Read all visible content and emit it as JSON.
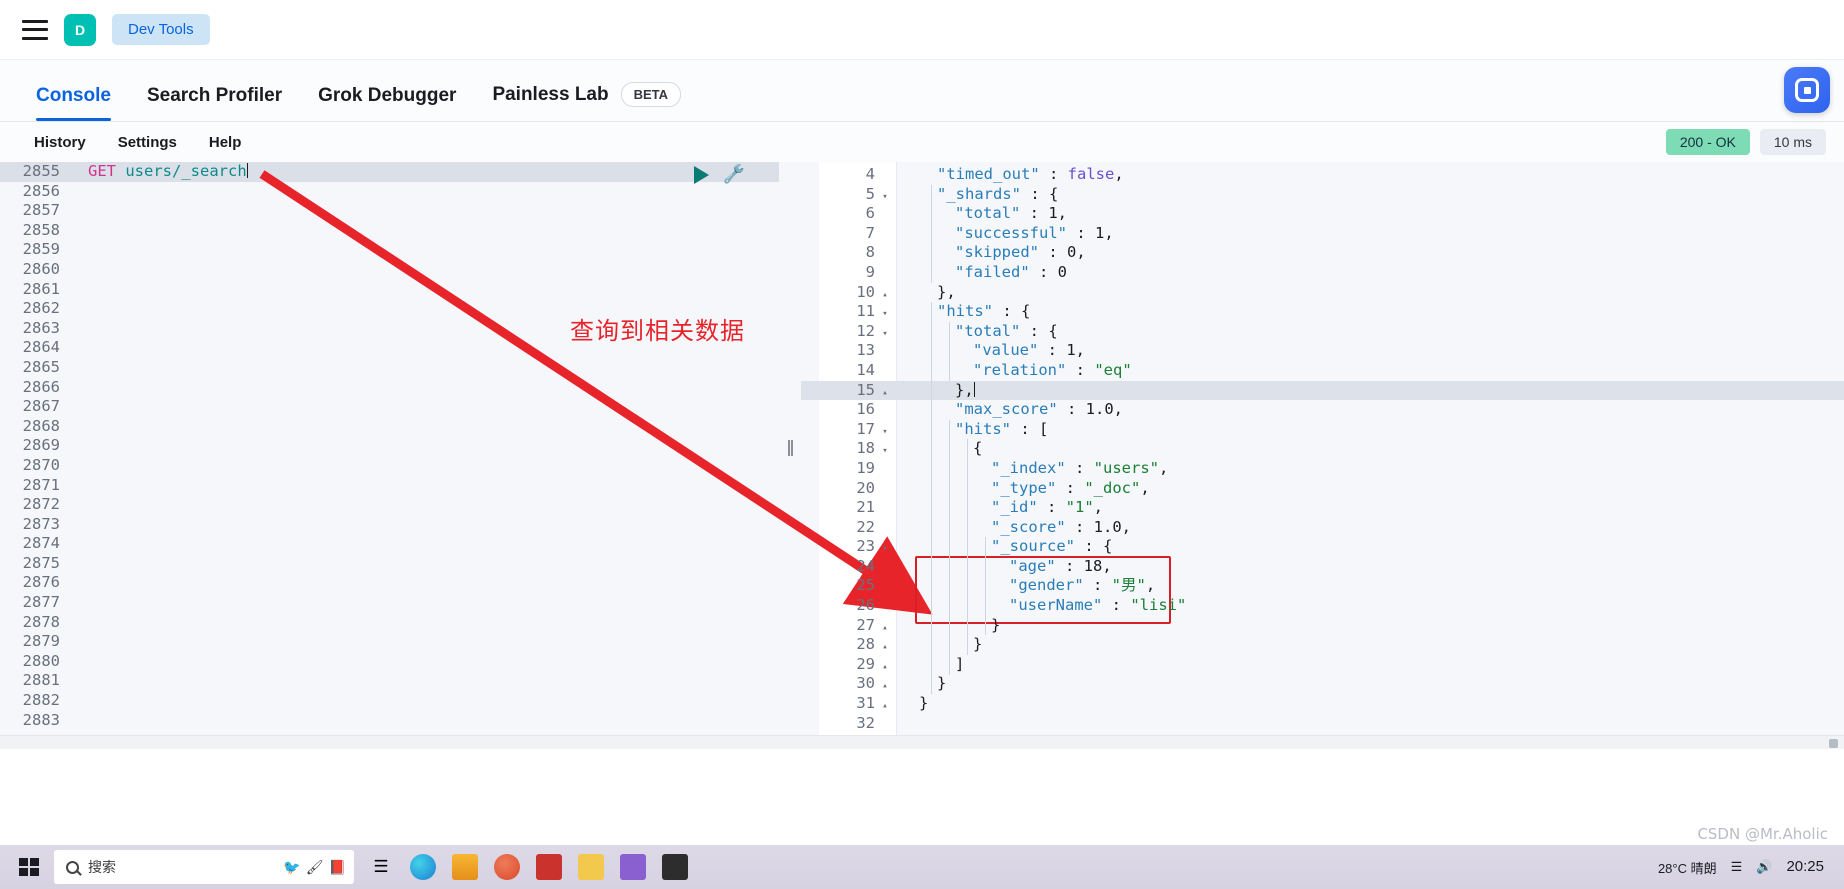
{
  "topbar": {
    "menu_icon": "hamburger-icon",
    "logo_letter": "D",
    "app_chip": "Dev Tools"
  },
  "tabs": [
    {
      "label": "Console",
      "active": true,
      "badge": null
    },
    {
      "label": "Search Profiler",
      "active": false,
      "badge": null
    },
    {
      "label": "Grok Debugger",
      "active": false,
      "badge": null
    },
    {
      "label": "Painless Lab",
      "active": false,
      "badge": "BETA"
    }
  ],
  "menu": {
    "items": [
      "History",
      "Settings",
      "Help"
    ],
    "status_code": "200 - OK",
    "duration": "10 ms"
  },
  "editor": {
    "actions": {
      "run": "play-icon",
      "wrench": "wrench-icon"
    },
    "request": {
      "method": "GET",
      "path": "users/_search"
    },
    "first_line": 2855,
    "line_numbers": [
      2855,
      2856,
      2857,
      2858,
      2859,
      2860,
      2861,
      2862,
      2863,
      2864,
      2865,
      2866,
      2867,
      2868,
      2869,
      2870,
      2871,
      2872,
      2873,
      2874,
      2875,
      2876,
      2877,
      2878,
      2879,
      2880,
      2881,
      2882,
      2883
    ]
  },
  "response": {
    "active_line": 15,
    "lines": [
      {
        "n": 4,
        "fold": "",
        "indent": 1,
        "tokens": [
          {
            "t": "\"timed_out\"",
            "c": "k"
          },
          {
            "t": " : ",
            "c": "p"
          },
          {
            "t": "false",
            "c": "b"
          },
          {
            "t": ",",
            "c": "p"
          }
        ]
      },
      {
        "n": 5,
        "fold": "▾",
        "indent": 1,
        "tokens": [
          {
            "t": "\"_shards\"",
            "c": "k"
          },
          {
            "t": " : {",
            "c": "p"
          }
        ]
      },
      {
        "n": 6,
        "fold": "",
        "indent": 2,
        "tokens": [
          {
            "t": "\"total\"",
            "c": "k"
          },
          {
            "t": " : ",
            "c": "p"
          },
          {
            "t": "1",
            "c": "n"
          },
          {
            "t": ",",
            "c": "p"
          }
        ]
      },
      {
        "n": 7,
        "fold": "",
        "indent": 2,
        "tokens": [
          {
            "t": "\"successful\"",
            "c": "k"
          },
          {
            "t": " : ",
            "c": "p"
          },
          {
            "t": "1",
            "c": "n"
          },
          {
            "t": ",",
            "c": "p"
          }
        ]
      },
      {
        "n": 8,
        "fold": "",
        "indent": 2,
        "tokens": [
          {
            "t": "\"skipped\"",
            "c": "k"
          },
          {
            "t": " : ",
            "c": "p"
          },
          {
            "t": "0",
            "c": "n"
          },
          {
            "t": ",",
            "c": "p"
          }
        ]
      },
      {
        "n": 9,
        "fold": "",
        "indent": 2,
        "tokens": [
          {
            "t": "\"failed\"",
            "c": "k"
          },
          {
            "t": " : ",
            "c": "p"
          },
          {
            "t": "0",
            "c": "n"
          }
        ]
      },
      {
        "n": 10,
        "fold": "▴",
        "indent": 1,
        "tokens": [
          {
            "t": "},",
            "c": "p"
          }
        ]
      },
      {
        "n": 11,
        "fold": "▾",
        "indent": 1,
        "tokens": [
          {
            "t": "\"hits\"",
            "c": "k"
          },
          {
            "t": " : {",
            "c": "p"
          }
        ]
      },
      {
        "n": 12,
        "fold": "▾",
        "indent": 2,
        "tokens": [
          {
            "t": "\"total\"",
            "c": "k"
          },
          {
            "t": " : {",
            "c": "p"
          }
        ]
      },
      {
        "n": 13,
        "fold": "",
        "indent": 3,
        "tokens": [
          {
            "t": "\"value\"",
            "c": "k"
          },
          {
            "t": " : ",
            "c": "p"
          },
          {
            "t": "1",
            "c": "n"
          },
          {
            "t": ",",
            "c": "p"
          }
        ]
      },
      {
        "n": 14,
        "fold": "",
        "indent": 3,
        "tokens": [
          {
            "t": "\"relation\"",
            "c": "k"
          },
          {
            "t": " : ",
            "c": "p"
          },
          {
            "t": "\"eq\"",
            "c": "s"
          }
        ]
      },
      {
        "n": 15,
        "fold": "▴",
        "indent": 2,
        "tokens": [
          {
            "t": "},",
            "c": "p"
          }
        ]
      },
      {
        "n": 16,
        "fold": "",
        "indent": 2,
        "tokens": [
          {
            "t": "\"max_score\"",
            "c": "k"
          },
          {
            "t": " : ",
            "c": "p"
          },
          {
            "t": "1.0",
            "c": "n"
          },
          {
            "t": ",",
            "c": "p"
          }
        ]
      },
      {
        "n": 17,
        "fold": "▾",
        "indent": 2,
        "tokens": [
          {
            "t": "\"hits\"",
            "c": "k"
          },
          {
            "t": " : [",
            "c": "p"
          }
        ]
      },
      {
        "n": 18,
        "fold": "▾",
        "indent": 3,
        "tokens": [
          {
            "t": "{",
            "c": "p"
          }
        ]
      },
      {
        "n": 19,
        "fold": "",
        "indent": 4,
        "tokens": [
          {
            "t": "\"_index\"",
            "c": "k"
          },
          {
            "t": " : ",
            "c": "p"
          },
          {
            "t": "\"users\"",
            "c": "s"
          },
          {
            "t": ",",
            "c": "p"
          }
        ]
      },
      {
        "n": 20,
        "fold": "",
        "indent": 4,
        "tokens": [
          {
            "t": "\"_type\"",
            "c": "k"
          },
          {
            "t": " : ",
            "c": "p"
          },
          {
            "t": "\"_doc\"",
            "c": "s"
          },
          {
            "t": ",",
            "c": "p"
          }
        ]
      },
      {
        "n": 21,
        "fold": "",
        "indent": 4,
        "tokens": [
          {
            "t": "\"_id\"",
            "c": "k"
          },
          {
            "t": " : ",
            "c": "p"
          },
          {
            "t": "\"1\"",
            "c": "s"
          },
          {
            "t": ",",
            "c": "p"
          }
        ]
      },
      {
        "n": 22,
        "fold": "",
        "indent": 4,
        "tokens": [
          {
            "t": "\"_score\"",
            "c": "k"
          },
          {
            "t": " : ",
            "c": "p"
          },
          {
            "t": "1.0",
            "c": "n"
          },
          {
            "t": ",",
            "c": "p"
          }
        ]
      },
      {
        "n": 23,
        "fold": "▾",
        "indent": 4,
        "tokens": [
          {
            "t": "\"_source\"",
            "c": "k"
          },
          {
            "t": " : {",
            "c": "p"
          }
        ]
      },
      {
        "n": 24,
        "fold": "",
        "indent": 5,
        "tokens": [
          {
            "t": "\"age\"",
            "c": "k"
          },
          {
            "t": " : ",
            "c": "p"
          },
          {
            "t": "18",
            "c": "n"
          },
          {
            "t": ",",
            "c": "p"
          }
        ]
      },
      {
        "n": 25,
        "fold": "",
        "indent": 5,
        "tokens": [
          {
            "t": "\"gender\"",
            "c": "k"
          },
          {
            "t": " : ",
            "c": "p"
          },
          {
            "t": "\"男\"",
            "c": "s"
          },
          {
            "t": ",",
            "c": "p"
          }
        ]
      },
      {
        "n": 26,
        "fold": "",
        "indent": 5,
        "tokens": [
          {
            "t": "\"userName\"",
            "c": "k"
          },
          {
            "t": " : ",
            "c": "p"
          },
          {
            "t": "\"lisi\"",
            "c": "s"
          }
        ]
      },
      {
        "n": 27,
        "fold": "▴",
        "indent": 4,
        "tokens": [
          {
            "t": "}",
            "c": "p"
          }
        ]
      },
      {
        "n": 28,
        "fold": "▴",
        "indent": 3,
        "tokens": [
          {
            "t": "}",
            "c": "p"
          }
        ]
      },
      {
        "n": 29,
        "fold": "▴",
        "indent": 2,
        "tokens": [
          {
            "t": "]",
            "c": "p"
          }
        ]
      },
      {
        "n": 30,
        "fold": "▴",
        "indent": 1,
        "tokens": [
          {
            "t": "}",
            "c": "p"
          }
        ]
      },
      {
        "n": 31,
        "fold": "▴",
        "indent": 0,
        "tokens": [
          {
            "t": "}",
            "c": "p"
          }
        ]
      },
      {
        "n": 32,
        "fold": "",
        "indent": 0,
        "tokens": []
      }
    ]
  },
  "annotations": {
    "note_text": "查询到相关数据",
    "accent_color": "#e8242b",
    "box_color": "#d91f26"
  },
  "taskbar": {
    "search_placeholder": "搜索",
    "clock_time": "20:25",
    "weather": "28°C  晴朗"
  },
  "watermark": "CSDN @Mr.Aholic"
}
